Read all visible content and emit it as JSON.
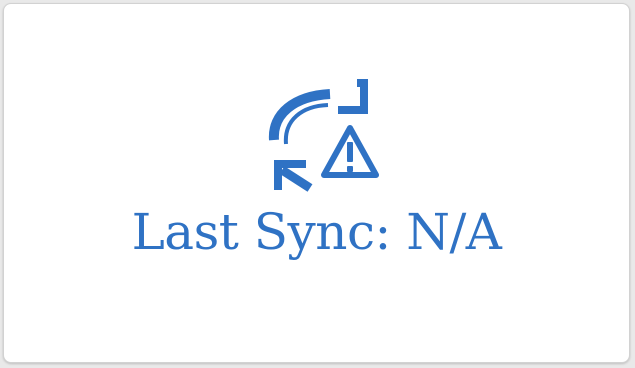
{
  "status": {
    "label": "Last Sync: N/A",
    "icon": "sync-warning-icon",
    "color": "#2f72c4"
  }
}
